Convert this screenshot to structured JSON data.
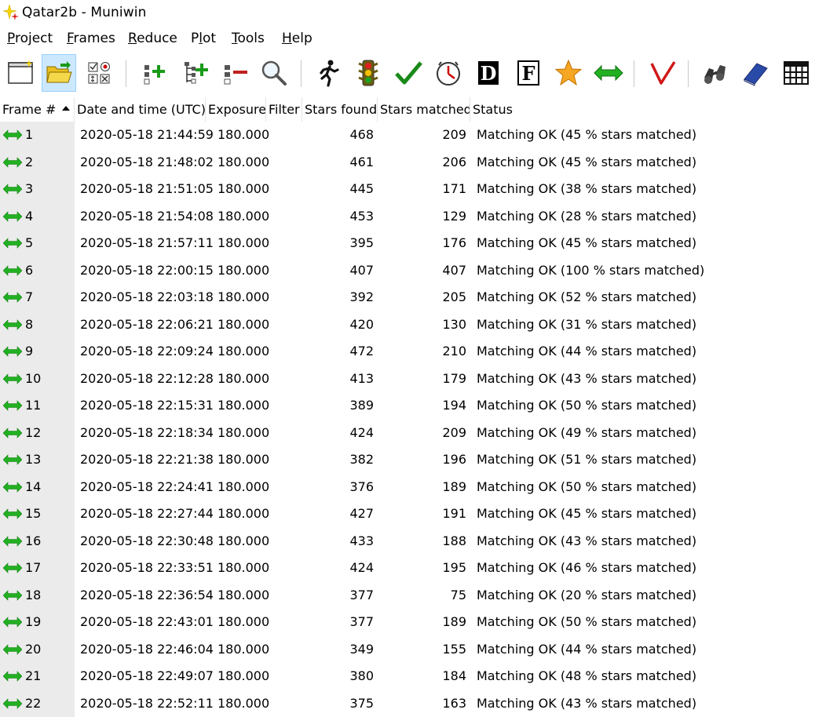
{
  "window": {
    "title": "Qatar2b - Muniwin",
    "app_icon": "sparkle-star-icon"
  },
  "menu": [
    {
      "key": "P",
      "rest": "roject"
    },
    {
      "key": "F",
      "rest": "rames"
    },
    {
      "key": "R",
      "rest": "educe"
    },
    {
      "key": "P",
      "rest": "lot",
      "prefix": "",
      "underline_index": 1
    },
    {
      "key": "T",
      "rest": "ools"
    },
    {
      "key": "H",
      "rest": "elp"
    }
  ],
  "toolbar": {
    "buttons": [
      "new-project-icon",
      "open-project-icon",
      "options-icon",
      "add-frames-icon",
      "add-individual-frames-icon",
      "remove-frames-icon",
      "show-frame-icon",
      "express-reduction-icon",
      "run-icon",
      "check-matching-icon",
      "time-correction-icon",
      "dark-frame-icon",
      "flat-frame-icon",
      "photometry-star-icon",
      "match-icon",
      "light-curve-icon",
      "find-variables-icon",
      "catalog-icon",
      "table-icon"
    ],
    "text_glyphs": {
      "dark": "D",
      "flat": "F"
    }
  },
  "colors": {
    "accent_green": "#1a9a1a",
    "frame_column_bg": "#ebebeb",
    "active_button_bg": "#cce8ff"
  },
  "table": {
    "columns": [
      "Frame #",
      "Date and time (UTC)",
      "Exposure",
      "Filter",
      "Stars found",
      "Stars matched",
      "Status"
    ],
    "sorted_column": "Frame #",
    "rows": [
      {
        "frame": "1",
        "datetime": "2020-05-18 21:44:59",
        "exposure": "180.000",
        "found": "468",
        "matched": "209",
        "status": "Matching OK (45 % stars matched)"
      },
      {
        "frame": "2",
        "datetime": "2020-05-18 21:48:02",
        "exposure": "180.000",
        "found": "461",
        "matched": "206",
        "status": "Matching OK (45 % stars matched)"
      },
      {
        "frame": "3",
        "datetime": "2020-05-18 21:51:05",
        "exposure": "180.000",
        "found": "445",
        "matched": "171",
        "status": "Matching OK (38 % stars matched)"
      },
      {
        "frame": "4",
        "datetime": "2020-05-18 21:54:08",
        "exposure": "180.000",
        "found": "453",
        "matched": "129",
        "status": "Matching OK (28 % stars matched)"
      },
      {
        "frame": "5",
        "datetime": "2020-05-18 21:57:11",
        "exposure": "180.000",
        "found": "395",
        "matched": "176",
        "status": "Matching OK (45 % stars matched)"
      },
      {
        "frame": "6",
        "datetime": "2020-05-18 22:00:15",
        "exposure": "180.000",
        "found": "407",
        "matched": "407",
        "status": "Matching OK (100 % stars matched)"
      },
      {
        "frame": "7",
        "datetime": "2020-05-18 22:03:18",
        "exposure": "180.000",
        "found": "392",
        "matched": "205",
        "status": "Matching OK (52 % stars matched)"
      },
      {
        "frame": "8",
        "datetime": "2020-05-18 22:06:21",
        "exposure": "180.000",
        "found": "420",
        "matched": "130",
        "status": "Matching OK (31 % stars matched)"
      },
      {
        "frame": "9",
        "datetime": "2020-05-18 22:09:24",
        "exposure": "180.000",
        "found": "472",
        "matched": "210",
        "status": "Matching OK (44 % stars matched)"
      },
      {
        "frame": "10",
        "datetime": "2020-05-18 22:12:28",
        "exposure": "180.000",
        "found": "413",
        "matched": "179",
        "status": "Matching OK (43 % stars matched)"
      },
      {
        "frame": "11",
        "datetime": "2020-05-18 22:15:31",
        "exposure": "180.000",
        "found": "389",
        "matched": "194",
        "status": "Matching OK (50 % stars matched)"
      },
      {
        "frame": "12",
        "datetime": "2020-05-18 22:18:34",
        "exposure": "180.000",
        "found": "424",
        "matched": "209",
        "status": "Matching OK (49 % stars matched)"
      },
      {
        "frame": "13",
        "datetime": "2020-05-18 22:21:38",
        "exposure": "180.000",
        "found": "382",
        "matched": "196",
        "status": "Matching OK (51 % stars matched)"
      },
      {
        "frame": "14",
        "datetime": "2020-05-18 22:24:41",
        "exposure": "180.000",
        "found": "376",
        "matched": "189",
        "status": "Matching OK (50 % stars matched)"
      },
      {
        "frame": "15",
        "datetime": "2020-05-18 22:27:44",
        "exposure": "180.000",
        "found": "427",
        "matched": "191",
        "status": "Matching OK (45 % stars matched)"
      },
      {
        "frame": "16",
        "datetime": "2020-05-18 22:30:48",
        "exposure": "180.000",
        "found": "433",
        "matched": "188",
        "status": "Matching OK (43 % stars matched)"
      },
      {
        "frame": "17",
        "datetime": "2020-05-18 22:33:51",
        "exposure": "180.000",
        "found": "424",
        "matched": "195",
        "status": "Matching OK (46 % stars matched)"
      },
      {
        "frame": "18",
        "datetime": "2020-05-18 22:36:54",
        "exposure": "180.000",
        "found": "377",
        "matched": "75",
        "status": "Matching OK (20 % stars matched)"
      },
      {
        "frame": "19",
        "datetime": "2020-05-18 22:43:01",
        "exposure": "180.000",
        "found": "377",
        "matched": "189",
        "status": "Matching OK (50 % stars matched)"
      },
      {
        "frame": "20",
        "datetime": "2020-05-18 22:46:04",
        "exposure": "180.000",
        "found": "349",
        "matched": "155",
        "status": "Matching OK (44 % stars matched)"
      },
      {
        "frame": "21",
        "datetime": "2020-05-18 22:49:07",
        "exposure": "180.000",
        "found": "380",
        "matched": "184",
        "status": "Matching OK (48 % stars matched)"
      },
      {
        "frame": "22",
        "datetime": "2020-05-18 22:52:11",
        "exposure": "180.000",
        "found": "375",
        "matched": "163",
        "status": "Matching OK (43 % stars matched)"
      }
    ]
  }
}
